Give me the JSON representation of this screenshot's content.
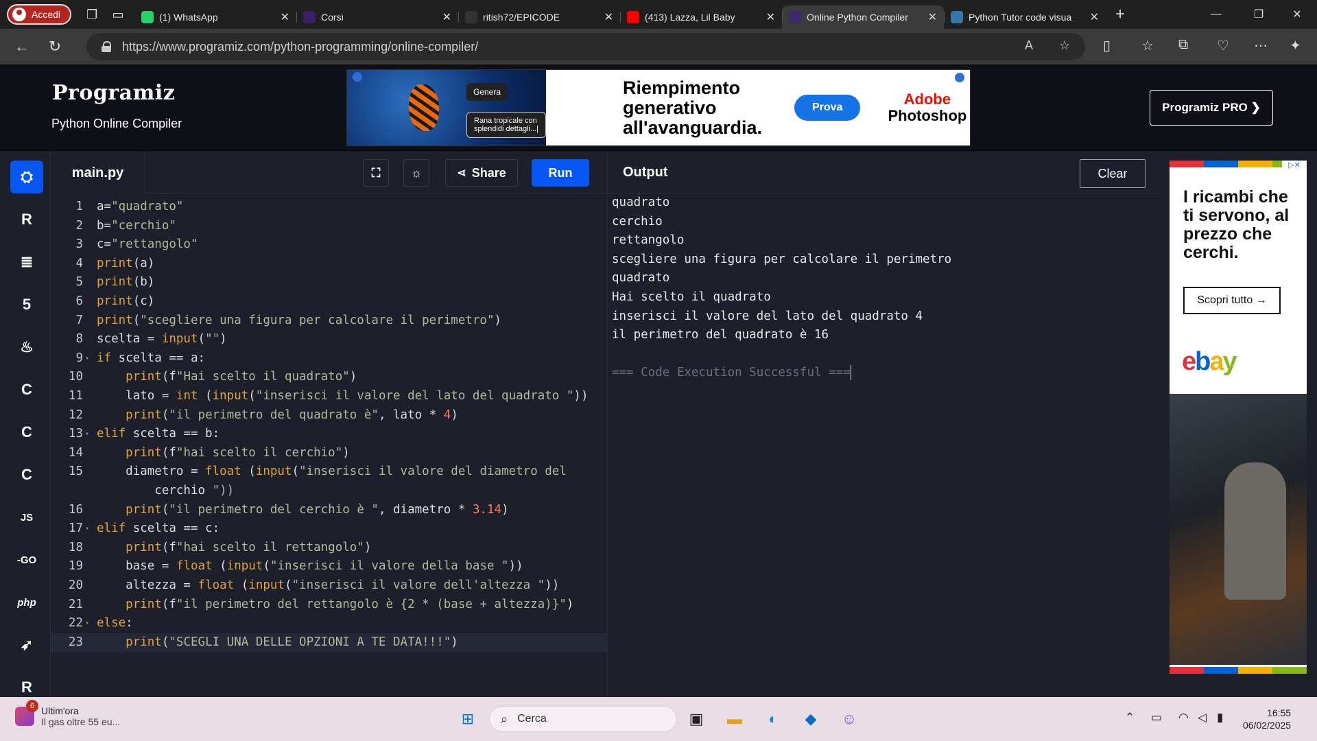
{
  "browser": {
    "profile_label": "Accedi",
    "tabs": [
      {
        "title": "(1) WhatsApp",
        "icon": "whatsapp-icon",
        "active": false
      },
      {
        "title": "Corsi",
        "icon": "corsi-icon",
        "active": false
      },
      {
        "title": "ritish72/EPICODE",
        "icon": "github-icon",
        "active": false
      },
      {
        "title": "(413) Lazza, Lil Baby",
        "icon": "youtube-icon",
        "active": false
      },
      {
        "title": "Online Python Compiler",
        "icon": "programiz-icon",
        "active": true
      },
      {
        "title": "Python Tutor code visua",
        "icon": "python-icon",
        "active": false
      }
    ],
    "url": "https://www.programiz.com/python-programming/online-compiler/"
  },
  "site": {
    "logo": "Programiz",
    "subtitle": "Python Online Compiler",
    "pro_button": "Programiz PRO ❯",
    "ad_top": {
      "pill1": "Genera",
      "pill2": "Rana tropicale con splendidi dettagli...|",
      "headline": "Riempimento generativo all'avanguardia.",
      "cta": "Prova",
      "brand_line1": "Adobe",
      "brand_line2": "Photoshop"
    }
  },
  "sidebar_languages": [
    {
      "name": "python",
      "label": "",
      "active": true
    },
    {
      "name": "r",
      "label": "R",
      "active": false
    },
    {
      "name": "sql",
      "label": "",
      "active": false
    },
    {
      "name": "html",
      "label": "5",
      "active": false
    },
    {
      "name": "java",
      "label": "",
      "active": false
    },
    {
      "name": "c",
      "label": "C",
      "active": false
    },
    {
      "name": "cpp",
      "label": "C",
      "active": false
    },
    {
      "name": "csharp",
      "label": "C",
      "active": false
    },
    {
      "name": "js",
      "label": "JS",
      "active": false
    },
    {
      "name": "go",
      "label": "-GO",
      "active": false
    },
    {
      "name": "php",
      "label": "php",
      "active": false
    },
    {
      "name": "swift",
      "label": "",
      "active": false
    },
    {
      "name": "rust",
      "label": "R",
      "active": false
    }
  ],
  "editor": {
    "filename": "main.py",
    "share_label": "Share",
    "run_label": "Run",
    "lines": [
      {
        "n": "1",
        "text": "a=\"quadrato\""
      },
      {
        "n": "2",
        "text": "b=\"cerchio\""
      },
      {
        "n": "3",
        "text": "c=\"rettangolo\""
      },
      {
        "n": "4",
        "text": "print(a)"
      },
      {
        "n": "5",
        "text": "print(b)"
      },
      {
        "n": "6",
        "text": "print(c)"
      },
      {
        "n": "7",
        "text": "print(\"scegliere una figura per calcolare il perimetro\")"
      },
      {
        "n": "8",
        "text": "scelta = input(\"\")"
      },
      {
        "n": "9",
        "text": "if scelta == a:",
        "fold": true
      },
      {
        "n": "10",
        "text": "    print(f\"Hai scelto il quadrato\")"
      },
      {
        "n": "11",
        "text": "    lato = int (input(\"inserisci il valore del lato del quadrato \"))"
      },
      {
        "n": "12",
        "text": "    print(\"il perimetro del quadrato è\", lato * 4)"
      },
      {
        "n": "13",
        "text": "elif scelta == b:",
        "fold": true
      },
      {
        "n": "14",
        "text": "    print(f\"hai scelto il cerchio\")"
      },
      {
        "n": "15",
        "text": "    diametro = float (input(\"inserisci il valore del diametro del"
      },
      {
        "n": "",
        "text": "        cerchio \"))"
      },
      {
        "n": "16",
        "text": "    print(\"il perimetro del cerchio è \", diametro * 3.14)"
      },
      {
        "n": "17",
        "text": "elif scelta == c:",
        "fold": true
      },
      {
        "n": "18",
        "text": "    print(f\"hai scelto il rettangolo\")"
      },
      {
        "n": "19",
        "text": "    base = float (input(\"inserisci il valore della base \"))"
      },
      {
        "n": "20",
        "text": "    altezza = float (input(\"inserisci il valore dell'altezza \"))"
      },
      {
        "n": "21",
        "text": "    print(f\"il perimetro del rettangolo è {2 * (base + altezza)}\")"
      },
      {
        "n": "22",
        "text": "else:",
        "fold": true
      },
      {
        "n": "23",
        "text": "    print(\"SCEGLI UNA DELLE OPZIONI A TE DATA!!!\")",
        "current": true
      }
    ]
  },
  "output": {
    "title": "Output",
    "clear_label": "Clear",
    "lines": [
      "quadrato",
      "cerchio",
      "rettangolo",
      "scegliere una figura per calcolare il perimetro",
      "quadrato",
      "Hai scelto il quadrato",
      "inserisci il valore del lato del quadrato 4",
      "il perimetro del quadrato è 16",
      ""
    ],
    "status": "=== Code Execution Successful ==="
  },
  "ad_right": {
    "headline": "I ricambi che ti servono, al prezzo che cerchi.",
    "cta": "Scopri tutto →",
    "brand": "ebay"
  },
  "taskbar": {
    "news_badge": "6",
    "news_title": "Ultim'ora",
    "news_text": "Il gas oltre 55 eu...",
    "search_placeholder": "Cerca",
    "time": "16:55",
    "date": "06/02/2025"
  },
  "colors": {
    "accent": "#0556f3",
    "editor_bg": "#1d1f2a",
    "header_bg": "#0f1017",
    "keyword": "#e0a23b",
    "string": "#b4b89a",
    "number": "#ff7a5a"
  }
}
